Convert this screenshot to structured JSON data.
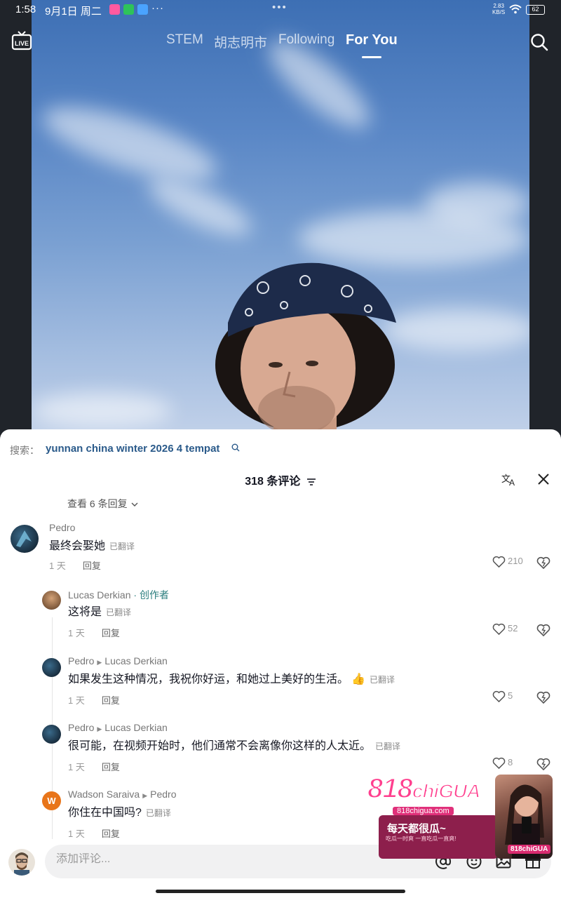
{
  "status_bar": {
    "time": "1:58",
    "date": "9月1日 周二",
    "more": "···",
    "center_dots": "•••",
    "net_speed": "2.83",
    "net_unit": "KB/S",
    "battery": "62"
  },
  "nav": {
    "live_label": "LIVE",
    "tabs": [
      {
        "label": "STEM"
      },
      {
        "label": "胡志明市"
      },
      {
        "label": "Following"
      },
      {
        "label": "For You"
      }
    ],
    "active_tab": "For You"
  },
  "sheet": {
    "search_prefix": "搜索：",
    "search_keyword": "yunnan china winter 2026 4 tempat",
    "title": "318 条评论",
    "view_replies": "查看 6 条回复"
  },
  "comments": [
    {
      "name": "Pedro",
      "reply_to": "",
      "badge": "",
      "text": "最终会娶她",
      "translated": "已翻译",
      "time": "1 天",
      "reply": "回复",
      "likes": "210"
    },
    {
      "name": "Lucas Derkian",
      "reply_to": "",
      "badge": "· 创作者",
      "text": "这将是",
      "translated": "已翻译",
      "time": "1 天",
      "reply": "回复",
      "likes": "52"
    },
    {
      "name": "Pedro",
      "reply_to": "Lucas Derkian",
      "badge": "",
      "text": "如果发生这种情况，我祝你好运，和她过上美好的生活。",
      "emoji": "👍",
      "translated": "已翻译",
      "time": "1 天",
      "reply": "回复",
      "likes": "5"
    },
    {
      "name": "Pedro",
      "reply_to": "Lucas Derkian",
      "badge": "",
      "text": "很可能，在视频开始时，他们通常不会离像你这样的人太近。",
      "translated": "已翻译",
      "time": "1 天",
      "reply": "回复",
      "likes": "8"
    },
    {
      "name": "Wadson Saraiva",
      "reply_to": "Pedro",
      "badge": "",
      "avatar_letter": "W",
      "text": "你住在中国吗?",
      "translated": "已翻译",
      "time": "1 天",
      "reply": "回复",
      "likes": ""
    }
  ],
  "input": {
    "placeholder": "添加评论..."
  },
  "ad": {
    "logo": "818",
    "logo_small": "chiGUA",
    "url": "818chigua.com",
    "slogan": "每天都很瓜~",
    "sub": "吃瓜一时爽 一直吃瓜一直爽!",
    "badge": "818chiGUA"
  },
  "colors": {
    "creator_badge": "#2a7d7d",
    "search_keyword": "#2a5a8a",
    "ad_pink": "#ff3f8e"
  }
}
